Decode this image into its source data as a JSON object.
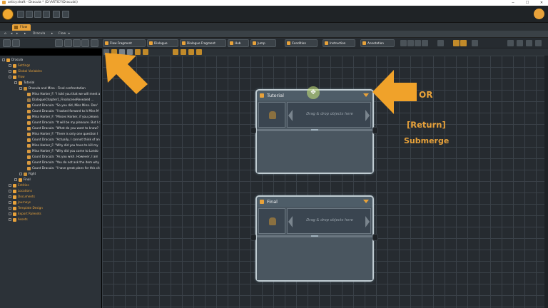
{
  "window": {
    "title": "articy:draft - Dracula * (D:\\ARTICY\\Dracula\\)",
    "minimize": "─",
    "maximize": "☐",
    "close": "✕"
  },
  "tabs": [
    {
      "label": "Flow"
    }
  ],
  "breadcrumb": {
    "home": "⌂",
    "back": "◂",
    "forward": "▸",
    "sep1": "▸",
    "project": "Dracula",
    "sep2": "▸",
    "current": "Flow",
    "sep3": "▸"
  },
  "ribbon": {
    "buttons": [
      {
        "label": "Flow Fragment"
      },
      {
        "label": "Dialogue"
      },
      {
        "label": "Dialogue Fragment"
      },
      {
        "label": "Hub"
      },
      {
        "label": "Jump"
      },
      {
        "label": "Condition"
      },
      {
        "label": "Instruction"
      },
      {
        "label": "Annotation"
      }
    ]
  },
  "tree": {
    "items": [
      {
        "label": "Dracula",
        "color": "white",
        "indent": 0
      },
      {
        "label": "Settings",
        "color": "orange",
        "indent": 1
      },
      {
        "label": "Global Variables",
        "color": "orange",
        "indent": 1
      },
      {
        "label": "Flow",
        "color": "orange",
        "indent": 1
      },
      {
        "label": "Tutorial",
        "color": "white",
        "indent": 2
      },
      {
        "label": "Dracula and Mina - Final confrontation",
        "color": "white",
        "indent": 3
      },
      {
        "label": "Mina Harker_F: \"I told you that we will meet a",
        "color": "white",
        "indent": 4
      },
      {
        "label": "DialogueChapter1_FinalsceneRevealed ...",
        "color": "white",
        "indent": 4
      },
      {
        "label": "Count Dracula: \"So you did, Miss Mina. Don'",
        "color": "white",
        "indent": 4
      },
      {
        "label": "Count Dracula: \"I looked forward to it Miss M",
        "color": "white",
        "indent": 4
      },
      {
        "label": "Mina Harker_F: \"Misses Harker, if you please.",
        "color": "white",
        "indent": 4
      },
      {
        "label": "Count Dracula: \"It will be my pleasure. But I c",
        "color": "white",
        "indent": 4
      },
      {
        "label": "Count Dracula: \"What do you want to know?",
        "color": "white",
        "indent": 4
      },
      {
        "label": "Mina Harker_F: \"There is only one question I",
        "color": "white",
        "indent": 4
      },
      {
        "label": "Count Dracula: \"Actually, I cannot think of an",
        "color": "white",
        "indent": 4
      },
      {
        "label": "Mina Harker_F: \"Why did you have to kill my",
        "color": "white",
        "indent": 4
      },
      {
        "label": "Mina Harker_F: \"Why did you come to Londo",
        "color": "white",
        "indent": 4
      },
      {
        "label": "Count Dracula: \"As you wish. However, I am",
        "color": "white",
        "indent": 4
      },
      {
        "label": "Count Dracula: \"You do not ask the item why",
        "color": "white",
        "indent": 4
      },
      {
        "label": "Count Dracula: \"I have great plans for this cit",
        "color": "white",
        "indent": 4
      },
      {
        "label": "Fight",
        "color": "white",
        "indent": 3
      },
      {
        "label": "Final",
        "color": "white",
        "indent": 2
      },
      {
        "label": "Entities",
        "color": "orange",
        "indent": 1
      },
      {
        "label": "Locations",
        "color": "orange",
        "indent": 1
      },
      {
        "label": "Documents",
        "color": "orange",
        "indent": 1
      },
      {
        "label": "Journeys",
        "color": "orange",
        "indent": 1
      },
      {
        "label": "Template Design",
        "color": "orange",
        "indent": 1
      },
      {
        "label": "Export Rulesets",
        "color": "orange",
        "indent": 1
      },
      {
        "label": "Assets",
        "color": "orange",
        "indent": 1
      }
    ]
  },
  "nodes": {
    "tutorial": {
      "title": "Tutorial",
      "drop_hint": "Drag & drop objects here"
    },
    "final": {
      "title": "Final",
      "drop_hint": "Drag & drop objects here"
    }
  },
  "annotations": {
    "or": "OR",
    "return": "[Return]",
    "submerge": "Submerge"
  },
  "colors": {
    "accent": "#e8a23a",
    "canvas": "#262b30",
    "node_border": "#c0ccd2"
  }
}
